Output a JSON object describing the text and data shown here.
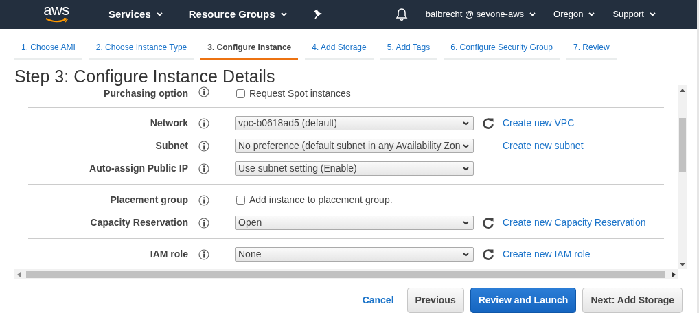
{
  "navbar": {
    "logo": "aws",
    "menus": [
      {
        "label": "Services",
        "kind": "dropdown"
      },
      {
        "label": "Resource Groups",
        "kind": "dropdown"
      },
      {
        "kind": "pin"
      }
    ],
    "right": [
      {
        "kind": "bell"
      },
      {
        "label": "balbrecht @ sevone-aws",
        "kind": "dropdown"
      },
      {
        "label": "Oregon",
        "kind": "dropdown"
      },
      {
        "label": "Support",
        "kind": "dropdown"
      }
    ]
  },
  "steps": [
    {
      "label": "1. Choose AMI",
      "selected": false
    },
    {
      "label": "2. Choose Instance Type",
      "selected": false
    },
    {
      "label": "3. Configure Instance",
      "selected": true
    },
    {
      "label": "4. Add Storage",
      "selected": false
    },
    {
      "label": "5. Add Tags",
      "selected": false
    },
    {
      "label": "6. Configure Security Group",
      "selected": false
    },
    {
      "label": "7. Review",
      "selected": false
    }
  ],
  "heading": "Step 3: Configure Instance Details",
  "sections": [
    {
      "rows": [
        {
          "label": "Purchasing option",
          "kind": "checkbox",
          "text": "Request Spot instances",
          "checked": false
        }
      ]
    },
    {
      "rows": [
        {
          "label": "Network",
          "kind": "select",
          "value": "vpc-b0618ad5 (default)",
          "refresh": true,
          "link": "Create new VPC"
        },
        {
          "label": "Subnet",
          "kind": "select",
          "value": "No preference (default subnet in any Availability Zon",
          "refresh": false,
          "link": "Create new subnet"
        },
        {
          "label": "Auto-assign Public IP",
          "kind": "select",
          "value": "Use subnet setting (Enable)",
          "refresh": false
        }
      ]
    },
    {
      "rows": [
        {
          "label": "Placement group",
          "kind": "checkbox",
          "text": "Add instance to placement group.",
          "checked": false
        },
        {
          "label": "Capacity Reservation",
          "kind": "select",
          "value": "Open",
          "refresh": true,
          "link": "Create new Capacity Reservation"
        }
      ]
    },
    {
      "rows": [
        {
          "label": "IAM role",
          "kind": "select",
          "value": "None",
          "refresh": true,
          "link": "Create new IAM role"
        }
      ]
    }
  ],
  "footer": [
    {
      "label": "Cancel",
      "kind": "link"
    },
    {
      "label": "Previous",
      "kind": "default"
    },
    {
      "label": "Review and Launch",
      "kind": "primary"
    },
    {
      "label": "Next: Add Storage",
      "kind": "default"
    }
  ]
}
